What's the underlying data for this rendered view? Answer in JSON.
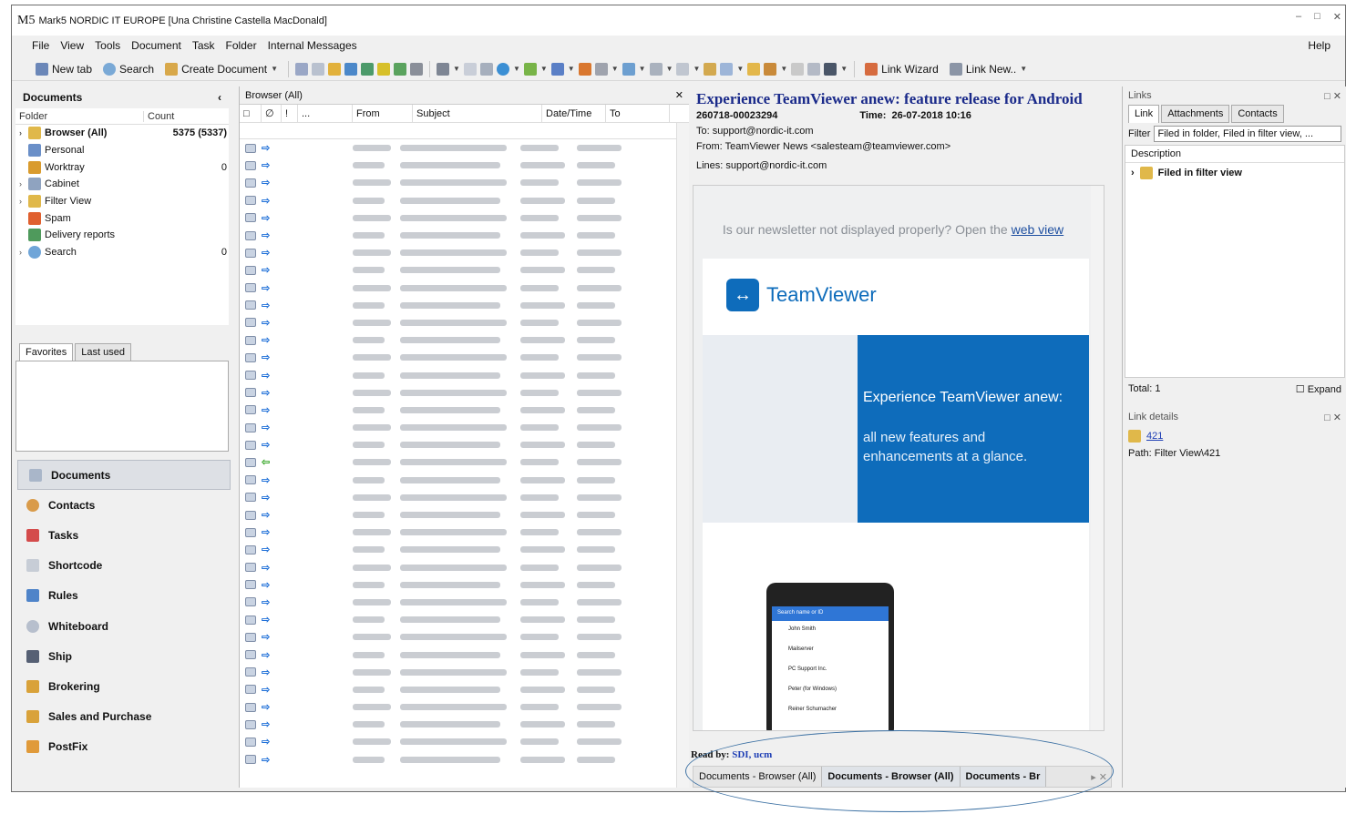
{
  "window": {
    "title": "Mark5 NORDIC IT EUROPE [Una Christine Castella MacDonald]"
  },
  "menu": {
    "items": [
      "File",
      "View",
      "Tools",
      "Document",
      "Task",
      "Folder",
      "Internal Messages"
    ],
    "help": "Help"
  },
  "toolbar": {
    "new_tab": "New tab",
    "search": "Search",
    "create_document": "Create Document",
    "link_wizard": "Link Wizard",
    "link_new": "Link New.."
  },
  "documents_panel": {
    "title": "Documents",
    "col_folder": "Folder",
    "col_count": "Count",
    "folders": [
      {
        "label": "Browser (All)",
        "count": "5375 (5337)",
        "bold": true,
        "icon": "browser-folder-icon"
      },
      {
        "label": "Personal",
        "count": "",
        "icon": "personal-folder-icon"
      },
      {
        "label": "Worktray",
        "count": "0",
        "icon": "worktray-icon"
      },
      {
        "label": "Cabinet",
        "count": "",
        "icon": "cabinet-icon"
      },
      {
        "label": "Filter View",
        "count": "",
        "icon": "filter-view-icon"
      },
      {
        "label": "Spam",
        "count": "",
        "icon": "spam-icon"
      },
      {
        "label": "Delivery reports",
        "count": "",
        "icon": "delivery-reports-icon"
      },
      {
        "label": "Search",
        "count": "0",
        "icon": "search-folder-icon"
      }
    ]
  },
  "favorites": {
    "tab_favorites": "Favorites",
    "tab_last_used": "Last used"
  },
  "nav": {
    "items": [
      "Documents",
      "Contacts",
      "Tasks",
      "Shortcode",
      "Rules",
      "Whiteboard",
      "Ship",
      "Brokering",
      "Sales and Purchase",
      "PostFix"
    ]
  },
  "browser": {
    "title": "Browser (All)",
    "col_from": "From",
    "col_subject": "Subject",
    "col_datetime": "Date/Time",
    "col_to": "To",
    "dots": "..."
  },
  "preview": {
    "subject": "Experience TeamViewer anew: feature release for Android",
    "doc_id": "260718-00023294",
    "time_label": "Time:",
    "time": "26-07-2018 10:16",
    "to": "To:   support@nordic-it.com",
    "from": "From: TeamViewer News <salesteam@teamviewer.com>",
    "lines": "Lines: support@nordic-it.com",
    "newsletter_text": "Is our newsletter not displayed properly? Open the",
    "web_view": "web view",
    "brand": "TeamViewer",
    "banner_title": "Experience TeamViewer anew:",
    "banner_sub": "all new features and enhancements at a glance.",
    "read_by_label": "Read by:",
    "read_by": "SDI, ucm",
    "tabs": [
      "Documents - Browser (All)",
      "Documents - Browser (All)",
      "Documents - Br"
    ],
    "phone_search": "Search name or ID",
    "phone_contacts": [
      "John Smith",
      "Mailserver",
      "PC Support Inc.",
      "Peter (for Windows)",
      "Reiner Schumacher"
    ]
  },
  "links_panel": {
    "title": "Links",
    "tabs": [
      "Link",
      "Attachments",
      "Contacts"
    ],
    "filter_label": "Filter",
    "filter_value": "Filed in folder, Filed in filter view, ...",
    "col_description": "Description",
    "item": "Filed in filter view",
    "total": "Total: 1",
    "expand": "Expand"
  },
  "link_details": {
    "title": "Link details",
    "id": "421",
    "path": "Path:  Filter View\\421"
  }
}
